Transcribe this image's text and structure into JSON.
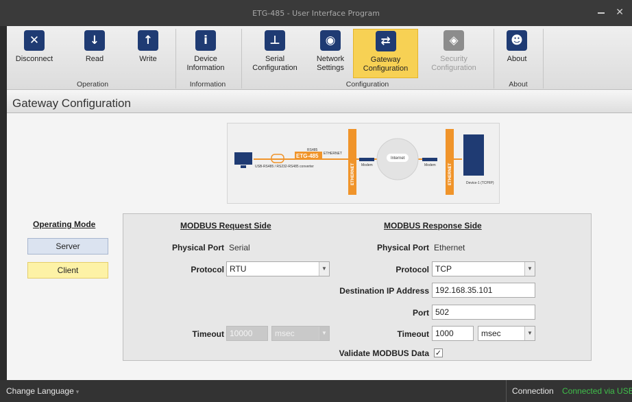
{
  "window": {
    "title": "ETG-485 - User Interface Program"
  },
  "ribbon": {
    "buttons": [
      {
        "label": "Disconnect",
        "icon": "close-x-icon"
      },
      {
        "label": "Read",
        "icon": "cloud-download-icon"
      },
      {
        "label": "Write",
        "icon": "cloud-upload-icon"
      },
      {
        "label": "Device\nInformation",
        "icon": "info-icon"
      },
      {
        "label": "Serial\nConfiguration",
        "icon": "network-tree-icon"
      },
      {
        "label": "Network\nSettings",
        "icon": "globe-network-icon"
      },
      {
        "label": "Gateway\nConfiguration",
        "icon": "gateway-swap-icon",
        "active": true
      },
      {
        "label": "Security\nConfiguration",
        "icon": "shield-lock-icon",
        "disabled": true
      },
      {
        "label": "About",
        "icon": "users-icon"
      }
    ],
    "groups": [
      "Operation",
      "Information",
      "Configuration",
      "About"
    ]
  },
  "page": {
    "title": "Gateway Configuration"
  },
  "diagram": {
    "labels": {
      "converter": "USB-RS485 / RS232-RS485\nconverter",
      "rs485": "RS485",
      "etg": "ETG-485",
      "ethernet_inline": "ETHERNET",
      "ethernet_bar1": "ETHERNET",
      "modem1": "Modem",
      "internet": "Internet",
      "modem2": "Modem",
      "ethernet_bar2": "ETHERNET",
      "device": "Device-1\n(TCP/IP)"
    }
  },
  "operating_mode": {
    "title": "Operating Mode",
    "server": "Server",
    "client": "Client"
  },
  "request_side": {
    "title": "MODBUS Request Side",
    "physical_port_label": "Physical Port",
    "physical_port": "Serial",
    "protocol_label": "Protocol",
    "protocol": "RTU",
    "timeout_label": "Timeout",
    "timeout": "10000",
    "timeout_unit": "msec"
  },
  "response_side": {
    "title": "MODBUS Response Side",
    "physical_port_label": "Physical Port",
    "physical_port": "Ethernet",
    "protocol_label": "Protocol",
    "protocol": "TCP",
    "dest_ip_label": "Destination IP Address",
    "dest_ip": "192.168.35.101",
    "port_label": "Port",
    "port": "502",
    "timeout_label": "Timeout",
    "timeout": "1000",
    "timeout_unit": "msec"
  },
  "validate": {
    "label": "Validate MODBUS Data",
    "checked": true
  },
  "statusbar": {
    "language": "Change Language",
    "connection_label": "Connection",
    "connection_value": "Connected via USB",
    "connection_color": "#3fbf4a"
  },
  "colors": {
    "active_button": "#f7d154",
    "icon_blue": "#1f3b73",
    "accent_orange": "#f0942a"
  }
}
